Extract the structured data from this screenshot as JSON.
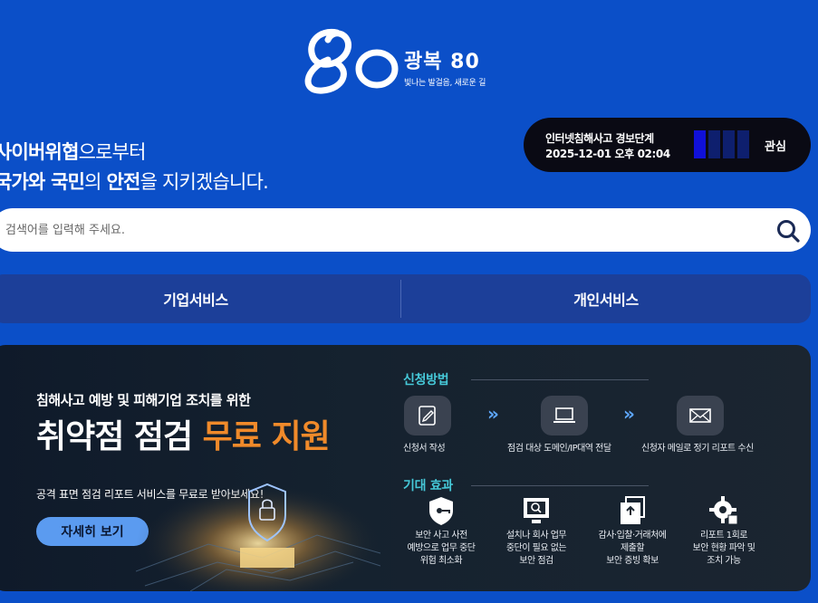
{
  "logo": {
    "mark": "80",
    "title": "광복 80",
    "subtitle": "빛나는 발걸음, 새로운 길"
  },
  "tagline": {
    "line1_bold": "사이버위협",
    "line1_rest": "으로부터",
    "line2_bold1": "국가와 국민",
    "line2_rest1": "의 ",
    "line2_bold2": "안전",
    "line2_rest2": "을 지키겠습니다."
  },
  "alert": {
    "title": "인터넷침해사고 경보단계",
    "time": "2025-12-01 오후 02:04",
    "level": "관심",
    "level_index": 1,
    "level_count": 4,
    "active_color": "#1010d8"
  },
  "search": {
    "placeholder": "검색어를 입력해 주세요.",
    "value": "",
    "icon": "search-icon"
  },
  "services": {
    "business": "기업서비스",
    "personal": "개인서비스"
  },
  "banner": {
    "subtitle": "침해사고 예방 및 피해기업 조치를 위한",
    "title_white": "취약점 점검 ",
    "title_orange": "무료 지원",
    "highlight_color": "#f08a2a",
    "description": "공격 표면 점검 리포트 서비스를 무료로 받아보세요!",
    "button": "자세히 보기",
    "apply_label": "신청방법",
    "steps": [
      {
        "icon": "edit-icon",
        "label": "신청서 작성"
      },
      {
        "icon": "laptop-icon",
        "label": "점검 대상 도메인/IP대역 전달"
      },
      {
        "icon": "mail-icon",
        "label": "신청자 메일로 정기 리포트 수신"
      }
    ],
    "effect_label": "기대 효과",
    "effects": [
      {
        "icon": "shield-key-icon",
        "lines": [
          "보안 사고 사전",
          "예방으로 업무 중단",
          "위험 최소화"
        ]
      },
      {
        "icon": "monitor-search-icon",
        "lines": [
          "설치나 회사 업무",
          "중단이 필요 없는",
          "보안 점검"
        ]
      },
      {
        "icon": "document-upload-icon",
        "lines": [
          "감사·입찰·거래처에",
          "제출할",
          "보안 증빙 확보"
        ]
      },
      {
        "icon": "gear-report-icon",
        "lines": [
          "리포트 1회로",
          "보안 현황 파악 및",
          "조치 가능"
        ]
      }
    ]
  },
  "colors": {
    "background": "#0b4fc8",
    "accent_teal": "#46c8d8",
    "button": "#5b9bf0"
  }
}
